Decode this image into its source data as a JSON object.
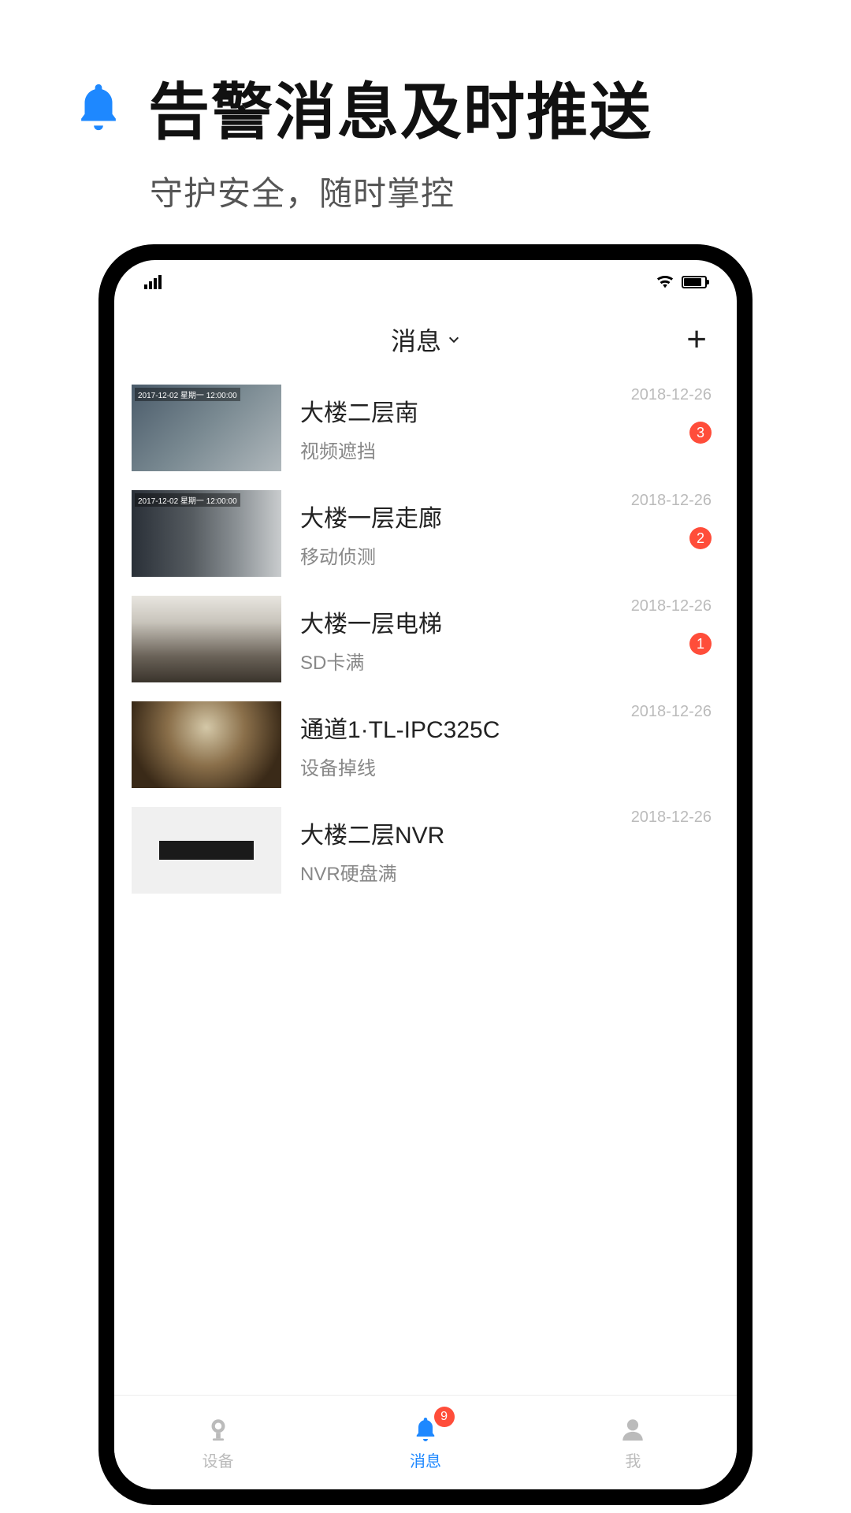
{
  "hero": {
    "title": "告警消息及时推送",
    "subtitle": "守护安全，随时掌控"
  },
  "app": {
    "header_title": "消息",
    "messages": [
      {
        "title": "大楼二层南",
        "subtitle": "视频遮挡",
        "date": "2018-12-26",
        "badge": "3",
        "thumb_label": "2017-12-02 星期一 12:00:00"
      },
      {
        "title": "大楼一层走廊",
        "subtitle": "移动侦测",
        "date": "2018-12-26",
        "badge": "2",
        "thumb_label": "2017-12-02 星期一 12:00:00"
      },
      {
        "title": "大楼一层电梯",
        "subtitle": "SD卡满",
        "date": "2018-12-26",
        "badge": "1",
        "thumb_label": ""
      },
      {
        "title": "通道1·TL-IPC325C",
        "subtitle": "设备掉线",
        "date": "2018-12-26",
        "badge": "",
        "thumb_label": ""
      },
      {
        "title": "大楼二层NVR",
        "subtitle": "NVR硬盘满",
        "date": "2018-12-26",
        "badge": "",
        "thumb_label": ""
      }
    ],
    "tabs": {
      "devices": "设备",
      "messages": "消息",
      "me": "我",
      "badge": "9"
    }
  }
}
